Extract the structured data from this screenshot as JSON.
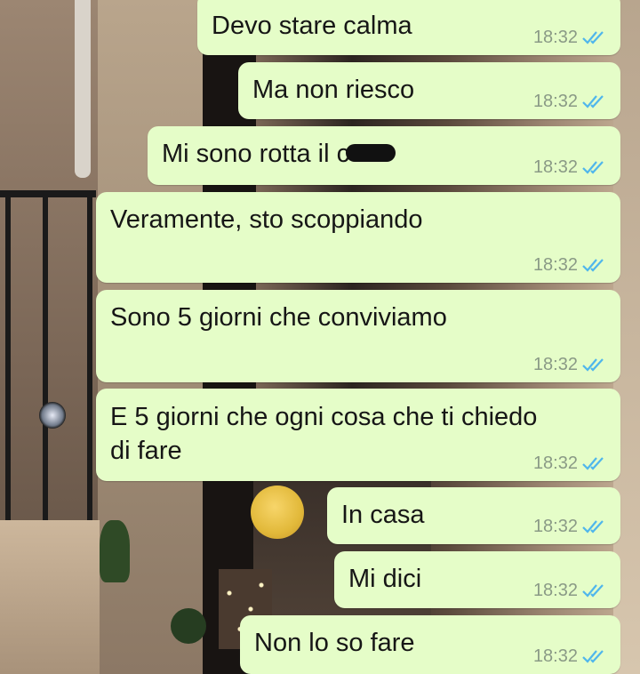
{
  "messages": [
    {
      "text": "Devo stare calma",
      "time": "18:32",
      "status": "read"
    },
    {
      "text": "Ma non riesco",
      "time": "18:32",
      "status": "read"
    },
    {
      "text": "Mi sono rotta il c",
      "redacted_suffix": true,
      "time": "18:32",
      "status": "read"
    },
    {
      "text": "Veramente, sto scoppiando",
      "time": "18:32",
      "status": "read"
    },
    {
      "text": "Sono 5 giorni che conviviamo",
      "time": "18:32",
      "status": "read"
    },
    {
      "text": "E 5 giorni che ogni cosa che ti chiedo\ndi fare",
      "time": "18:32",
      "status": "read"
    },
    {
      "text": "In casa",
      "time": "18:32",
      "status": "read"
    },
    {
      "text": "Mi dici",
      "time": "18:32",
      "status": "read"
    },
    {
      "text": "Non lo so fare",
      "time": "18:32",
      "status": "read"
    }
  ],
  "colors": {
    "bubble_outgoing": "#e5fdc8",
    "read_ticks": "#4fb6ec",
    "time_text": "#8a9a86"
  },
  "icons": {
    "status": "double-check-read-icon"
  }
}
